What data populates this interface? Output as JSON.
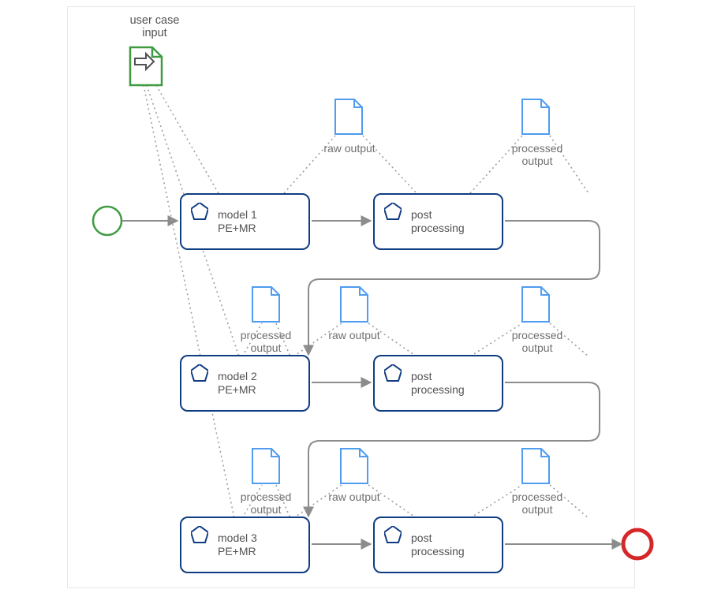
{
  "title": "user case\ninput",
  "nodes": {
    "model1": "model 1\nPE+MR",
    "post1": "post\nprocessing",
    "model2": "model 2\nPE+MR",
    "post2": "post\nprocessing",
    "model3": "model 3\nPE+MR",
    "post3": "post\nprocessing"
  },
  "docs": {
    "raw1": "raw output",
    "proc1": "processed\noutput",
    "proc_in2": "processed\noutput",
    "raw2": "raw output",
    "proc2": "processed\noutput",
    "proc_in3": "processed\noutput",
    "raw3": "raw output",
    "proc3": "processed\noutput"
  },
  "colors": {
    "boxBorder": "#103d82",
    "start": "#3f9b41",
    "end": "#d62728",
    "docStroke": "#4f9cf0",
    "arrow": "#8c8c8c",
    "dotted": "#9e9e9e"
  }
}
